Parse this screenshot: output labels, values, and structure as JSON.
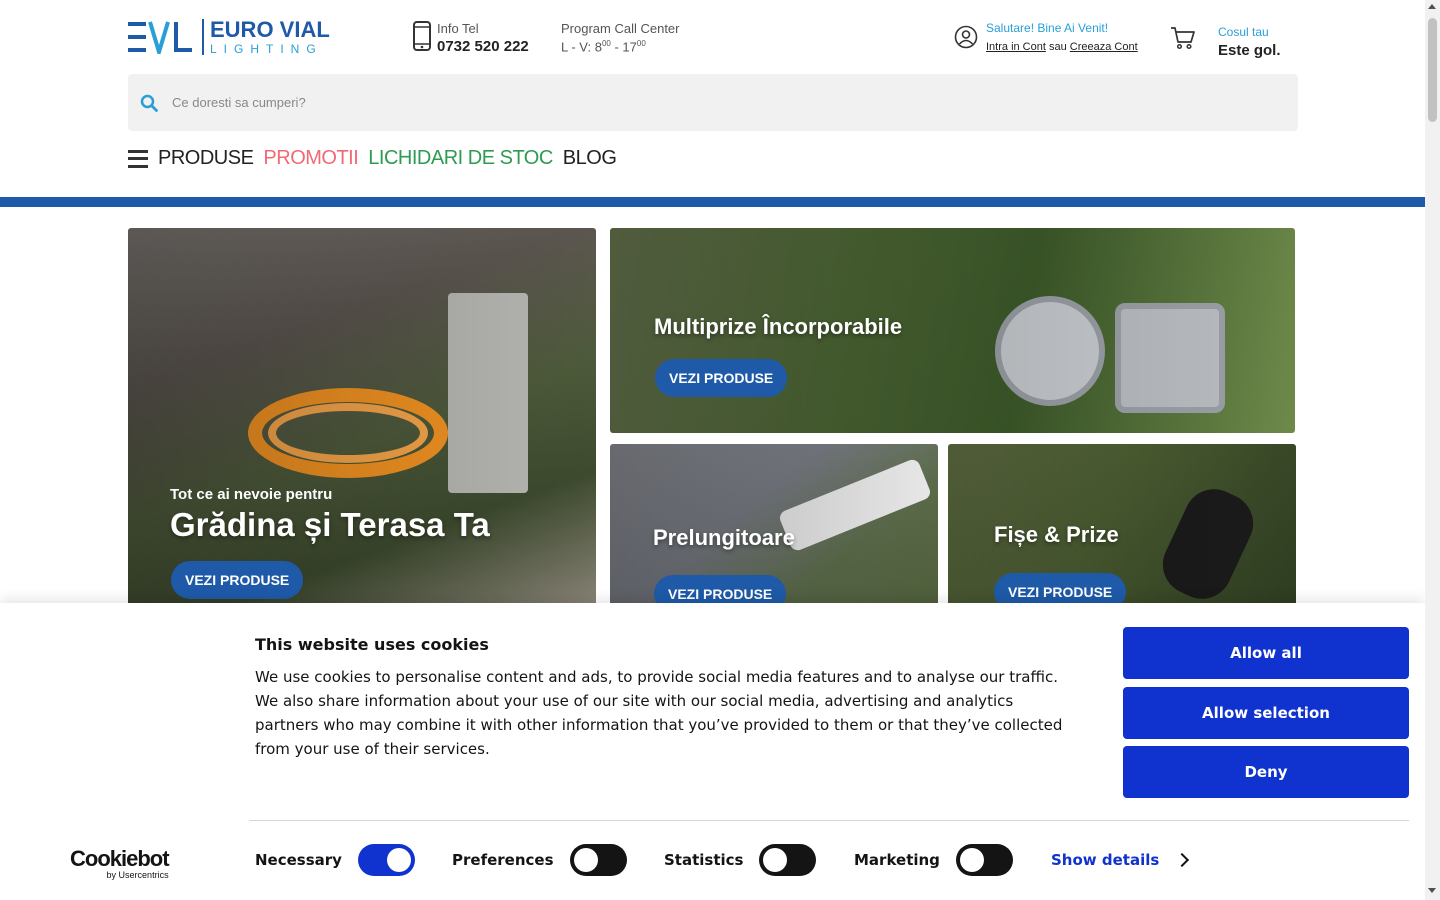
{
  "header": {
    "logo": {
      "brand_line1": "EURO VIAL",
      "brand_line2": "LIGHTING",
      "mark": "EVL"
    },
    "phone": {
      "label": "Info Tel",
      "number": "0732 520 222",
      "icon": "phone-icon"
    },
    "call_center": {
      "label": "Program Call Center",
      "hours_prefix": "L - V: 8",
      "hours_sup1": "00",
      "hours_mid": " - 17",
      "hours_sup2": "00"
    },
    "account": {
      "greeting": "Salutare! Bine Ai Venit!",
      "login": "Intra in Cont",
      "sep": "sau",
      "register": "Creeaza Cont",
      "icon": "user-icon"
    },
    "cart": {
      "label": "Cosul tau",
      "status": "Este gol.",
      "icon": "cart-icon"
    },
    "search": {
      "placeholder": "Ce doresti sa cumperi?",
      "icon": "search-icon"
    },
    "nav": [
      {
        "label": "PRODUSE",
        "color": "#222222"
      },
      {
        "label": "PROMOTII",
        "color": "#f06a75"
      },
      {
        "label": "LICHIDARI DE STOC",
        "color": "#2e9a52"
      },
      {
        "label": "BLOG",
        "color": "#222222"
      }
    ],
    "accent_color": "#1e5aa8"
  },
  "banners": {
    "big": {
      "pre": "Tot ce ai nevoie pentru",
      "title": "Grădina și Terasa Ta",
      "button": "VEZI PRODUSE"
    },
    "top": {
      "title": "Multiprize Încorporabile",
      "button": "VEZI PRODUSE"
    },
    "mid": {
      "title": "Prelungitoare",
      "button": "VEZI PRODUSE"
    },
    "right": {
      "title": "Fișe & Prize",
      "button": "VEZI PRODUSE"
    }
  },
  "cookie": {
    "title": "This website uses cookies",
    "description": "We use cookies to personalise content and ads, to provide social media features and to analyse our traffic. We also share information about your use of our site with our social media, advertising and analytics partners who may combine it with other information that you’ve provided to them or that they’ve collected from your use of their services.",
    "buttons": {
      "allow_all": "Allow all",
      "allow_selection": "Allow selection",
      "deny": "Deny"
    },
    "brand": {
      "name": "Cookiebot",
      "sub": "by Usercentrics"
    },
    "toggles": [
      {
        "label": "Necessary",
        "on": true
      },
      {
        "label": "Preferences",
        "on": false
      },
      {
        "label": "Statistics",
        "on": false
      },
      {
        "label": "Marketing",
        "on": false
      }
    ],
    "show_details": "Show details",
    "button_color": "#1032cf"
  }
}
